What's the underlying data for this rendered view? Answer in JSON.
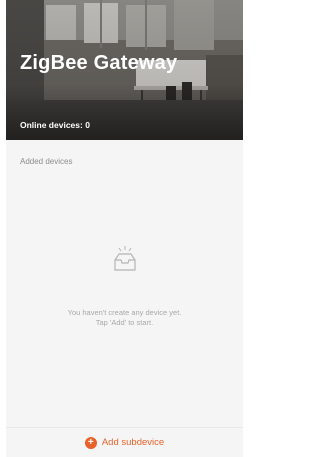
{
  "hero": {
    "title": "ZigBee Gateway",
    "online_devices": "Online devices: 0"
  },
  "list": {
    "section_label": "Added devices",
    "empty_line1": "You haven't create any device yet.",
    "empty_line2": "Tap 'Add' to start."
  },
  "footer": {
    "add_label": "Add subdevice",
    "plus_glyph": "+"
  },
  "colors": {
    "accent": "#e8632b",
    "background": "#f5f5f5"
  },
  "icons": {
    "empty": "empty-tray-icon",
    "add": "plus-circle-icon"
  }
}
